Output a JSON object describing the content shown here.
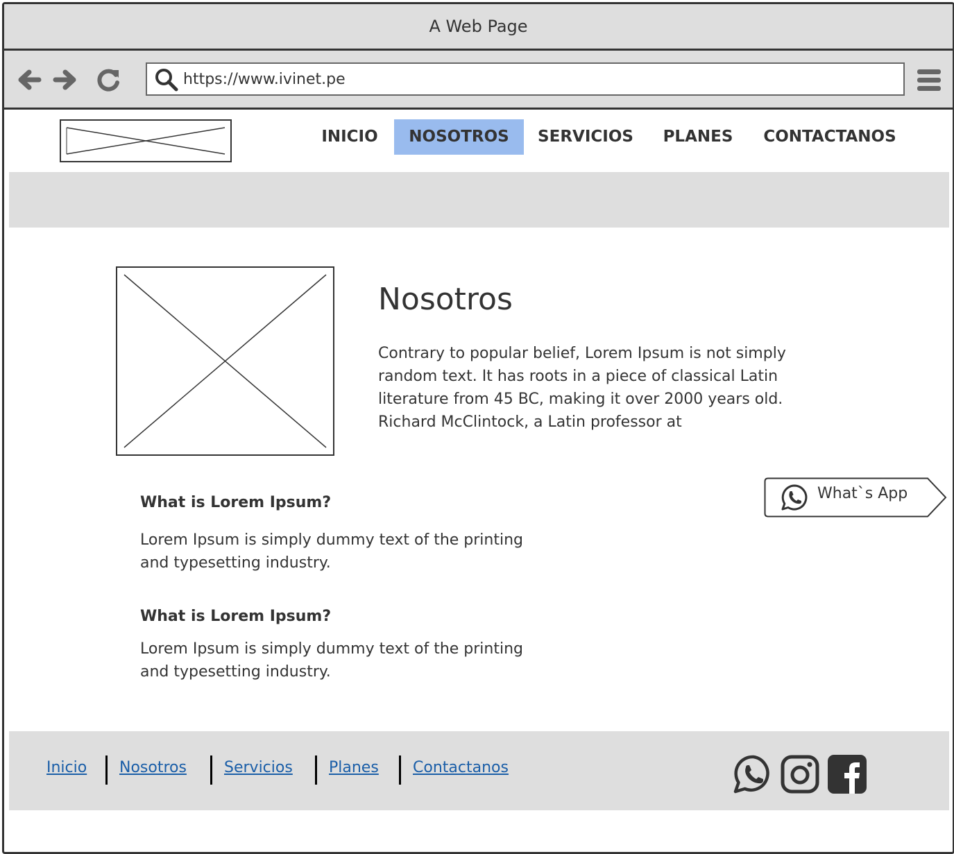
{
  "window": {
    "title": "A Web Page"
  },
  "browser": {
    "url": "https://www.ivinet.pe",
    "back_icon": "arrow-left-icon",
    "forward_icon": "arrow-right-icon",
    "reload_icon": "reload-icon",
    "menu_icon": "hamburger-icon"
  },
  "nav": {
    "items": [
      {
        "label": "INICIO"
      },
      {
        "label": "NOSOTROS",
        "active": true
      },
      {
        "label": "SERVICIOS"
      },
      {
        "label": "PLANES"
      },
      {
        "label": "CONTACTANOS"
      }
    ],
    "active_color": "#99bbee"
  },
  "main": {
    "title": "Nosotros",
    "intro": "Contrary to popular belief, Lorem Ipsum is not simply random text. It has roots in a piece of classical Latin literature from 45 BC, making it over 2000 years old. Richard McClintock, a Latin professor at",
    "sections": [
      {
        "title": "What is Lorem Ipsum?",
        "text": "Lorem Ipsum is simply dummy text of the printing and typesetting industry."
      },
      {
        "title": "What is Lorem Ipsum?",
        "text": "Lorem Ipsum is simply dummy text of the printing and typesetting industry."
      }
    ]
  },
  "whatsapp_button": {
    "label": "What`s App",
    "icon": "whatsapp-icon"
  },
  "footer": {
    "links": [
      {
        "label": "Inicio"
      },
      {
        "label": "Nosotros"
      },
      {
        "label": "Servicios"
      },
      {
        "label": "Planes"
      },
      {
        "label": "Contactanos"
      }
    ],
    "link_color": "#1a5ea8",
    "social_icons": [
      "whatsapp-icon",
      "instagram-icon",
      "facebook-icon"
    ]
  },
  "colors": {
    "chrome": "#dedede",
    "border": "#333333",
    "hero": "#dedede"
  }
}
